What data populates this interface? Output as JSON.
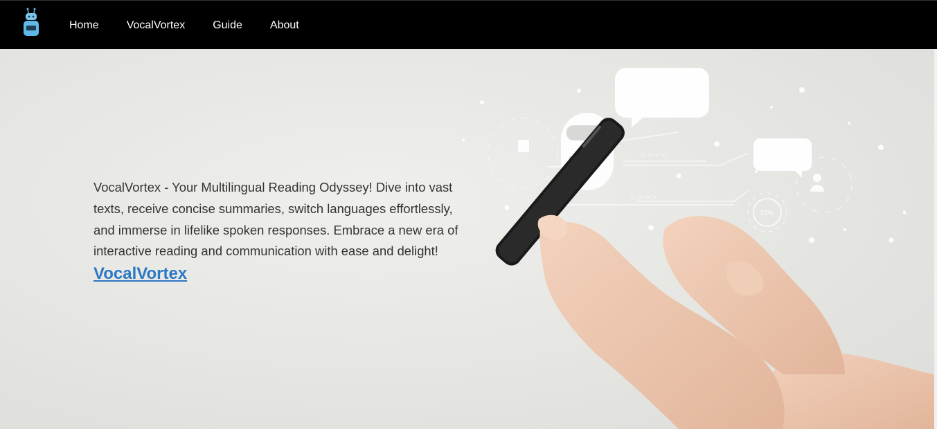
{
  "nav": {
    "links": [
      {
        "label": "Home"
      },
      {
        "label": "VocalVortex"
      },
      {
        "label": "Guide"
      },
      {
        "label": "About"
      }
    ]
  },
  "hero": {
    "description": "VocalVortex - Your Multilingual Reading Odyssey! Dive into vast texts, receive concise summaries, switch languages effortlessly, and immerse in lifelike spoken responses. Embrace a new era of interactive reading and communication with ease and delight!",
    "link_label": "VocalVortex",
    "progress_text": "75%"
  },
  "colors": {
    "nav_bg": "#000000",
    "nav_text": "#ffffff",
    "link": "#2b78c4",
    "logo": "#5fb8e8"
  },
  "icons": {
    "logo": "robot-icon"
  }
}
